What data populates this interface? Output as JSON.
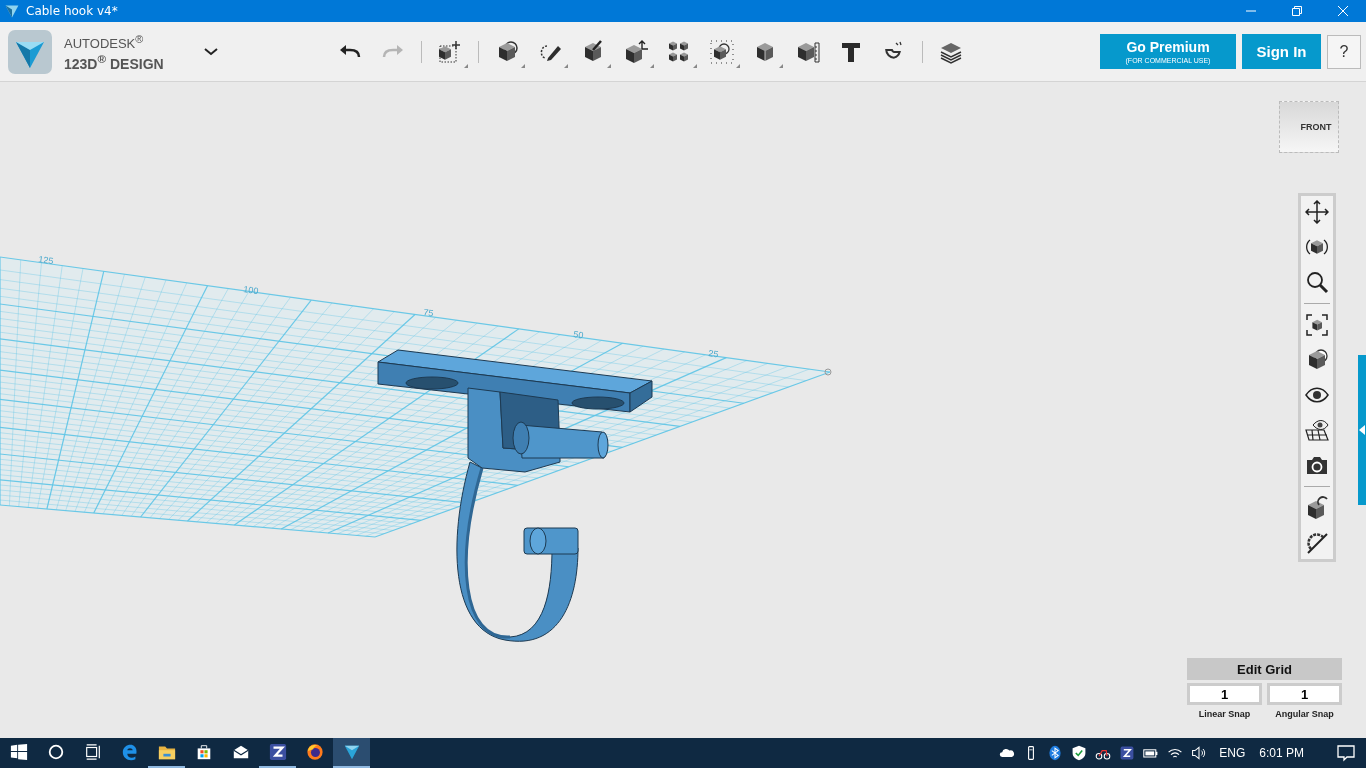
{
  "window": {
    "title": "Cable hook v4*"
  },
  "header": {
    "brand_top": "AUTODESK$^{®}$",
    "brand_bottom": "123D$^{®}$ DESIGN"
  },
  "toolbar": {
    "undo": {
      "disabled": false
    },
    "redo": {
      "disabled": true
    },
    "groups": [
      [
        {
          "kind": "transform",
          "dropdown": true
        }
      ],
      [
        {
          "kind": "primitives",
          "dropdown": true
        },
        {
          "kind": "sketch",
          "dropdown": true
        },
        {
          "kind": "construct",
          "dropdown": true
        },
        {
          "kind": "modify",
          "dropdown": true
        },
        {
          "kind": "pattern",
          "dropdown": true
        },
        {
          "kind": "grouping",
          "dropdown": true
        },
        {
          "kind": "combine",
          "dropdown": true
        },
        {
          "kind": "measure",
          "dropdown": false
        },
        {
          "kind": "text",
          "dropdown": false
        },
        {
          "kind": "snap",
          "dropdown": false
        }
      ],
      [
        {
          "kind": "materials",
          "dropdown": false
        }
      ]
    ]
  },
  "account": {
    "premium_label": "Go Premium",
    "premium_note": "(FOR COMMERCIAL USE)",
    "sign_in": "Sign In",
    "help": "?"
  },
  "viewport": {
    "grid_labels": [
      "125",
      "100",
      "75",
      "50",
      "25"
    ],
    "view_cube": {
      "face": "FRONT"
    },
    "nav_tools": [
      {
        "kind": "pan"
      },
      {
        "kind": "orbit"
      },
      {
        "kind": "zoom"
      },
      {
        "kind": "separator"
      },
      {
        "kind": "fit"
      },
      {
        "kind": "material"
      },
      {
        "kind": "visibility"
      },
      {
        "kind": "grid-visibility"
      },
      {
        "kind": "screenshot"
      },
      {
        "kind": "separator"
      },
      {
        "kind": "snap"
      },
      {
        "kind": "hide-snap"
      }
    ],
    "edit_grid": {
      "title": "Edit Grid",
      "linear_value": "1",
      "linear_label": "Linear Snap",
      "angular_value": "1",
      "angular_label": "Angular Snap"
    }
  },
  "taskbar": {
    "apps": [
      {
        "kind": "edge",
        "running": false,
        "selected": false
      },
      {
        "kind": "explorer",
        "running": true,
        "selected": false
      },
      {
        "kind": "store",
        "running": false,
        "selected": false
      },
      {
        "kind": "mail",
        "running": false,
        "selected": false
      },
      {
        "kind": "zapp",
        "running": true,
        "selected": false
      },
      {
        "kind": "firefox",
        "running": false,
        "selected": false
      },
      {
        "kind": "design",
        "running": true,
        "selected": true
      }
    ],
    "tray": [
      {
        "kind": "cloud"
      },
      {
        "kind": "usb"
      },
      {
        "kind": "bluetooth"
      },
      {
        "kind": "shield"
      },
      {
        "kind": "network-app"
      },
      {
        "kind": "zapp"
      },
      {
        "kind": "battery"
      },
      {
        "kind": "wifi"
      },
      {
        "kind": "volume"
      }
    ],
    "language": "ENG",
    "time": "6:01 PM"
  }
}
